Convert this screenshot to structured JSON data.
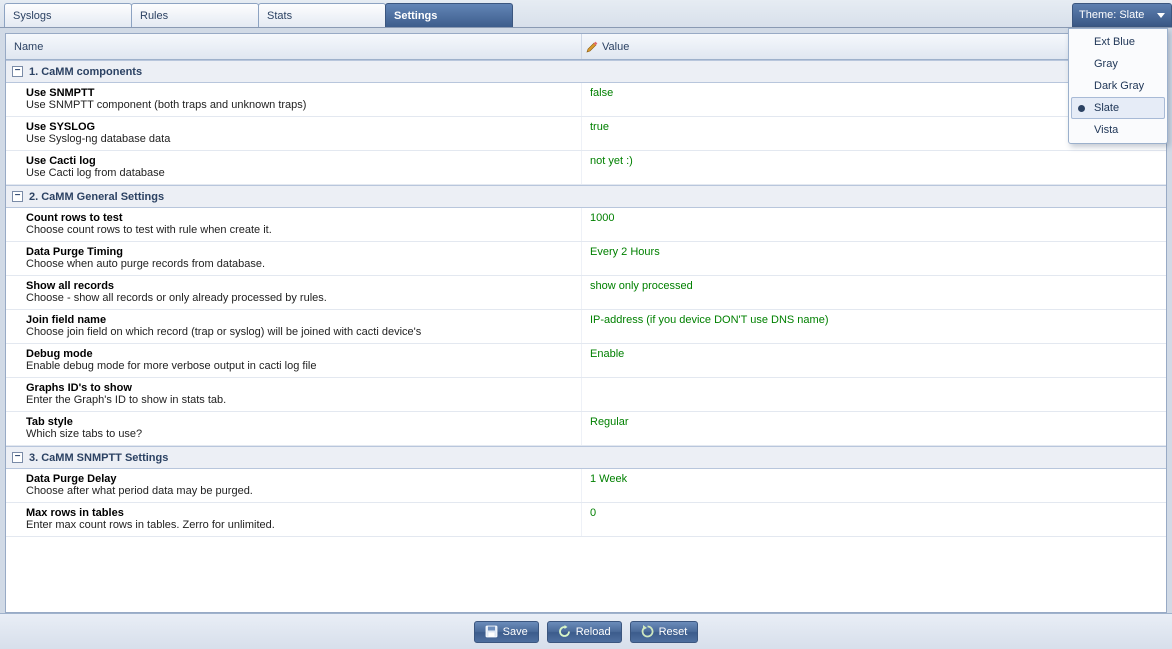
{
  "tabs": [
    {
      "label": "Syslogs"
    },
    {
      "label": "Rules"
    },
    {
      "label": "Stats"
    },
    {
      "label": "Settings"
    }
  ],
  "active_tab": 3,
  "theme_selector": {
    "label": "Theme: Slate"
  },
  "theme_menu": {
    "items": [
      {
        "label": "Ext Blue"
      },
      {
        "label": "Gray"
      },
      {
        "label": "Dark Gray"
      },
      {
        "label": "Slate"
      },
      {
        "label": "Vista"
      }
    ],
    "selected_index": 3
  },
  "columns": {
    "name": "Name",
    "value": "Value"
  },
  "groups": [
    {
      "title": "1. CaMM components",
      "rows": [
        {
          "name": "Use SNMPTT",
          "desc": "Use SNMPTT component (both traps and unknown traps)",
          "value": "false"
        },
        {
          "name": "Use SYSLOG",
          "desc": "Use Syslog-ng database data",
          "value": "true"
        },
        {
          "name": "Use Cacti log",
          "desc": "Use Cacti log from database",
          "value": "not yet :)"
        }
      ]
    },
    {
      "title": "2. CaMM General Settings",
      "rows": [
        {
          "name": "Count rows to test",
          "desc": "Choose count rows to test with rule when create it.",
          "value": "1000"
        },
        {
          "name": "Data Purge Timing",
          "desc": "Choose when auto purge records from database.",
          "value": "Every 2 Hours"
        },
        {
          "name": "Show all records",
          "desc": "Choose - show all records or only already processed by rules.",
          "value": "show only processed"
        },
        {
          "name": "Join field name",
          "desc": "Choose join field on which record (trap or syslog) will be joined with cacti device's",
          "value": "IP-address (if you device DON'T use DNS name)"
        },
        {
          "name": "Debug mode",
          "desc": "Enable debug mode for more verbose output in cacti log file",
          "value": "Enable"
        },
        {
          "name": "Graphs ID's to show",
          "desc": "Enter the Graph's ID to show in stats tab.",
          "value": ""
        },
        {
          "name": "Tab style",
          "desc": "Which size tabs to use?",
          "value": "Regular"
        }
      ]
    },
    {
      "title": "3. CaMM SNMPTT Settings",
      "rows": [
        {
          "name": "Data Purge Delay",
          "desc": "Choose after what period data may be purged.",
          "value": "1 Week"
        },
        {
          "name": "Max rows in tables",
          "desc": "Enter max count rows in tables. Zerro for unlimited.",
          "value": "0"
        }
      ]
    }
  ],
  "toolbar": {
    "save": "Save",
    "reload": "Reload",
    "reset": "Reset"
  }
}
